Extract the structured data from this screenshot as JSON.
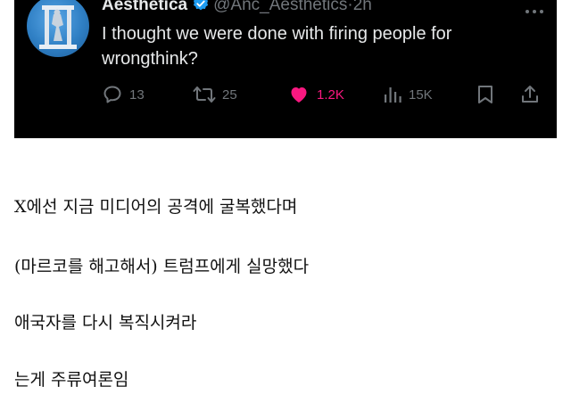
{
  "tweet": {
    "display_name": "Aesthetica",
    "handle": "@Anc_Aesthetics",
    "separator": "·",
    "time": "2h",
    "text": "I thought we were done with firing people for wrongthink?",
    "actions": {
      "replies": "13",
      "reposts": "25",
      "likes": "1.2K",
      "views": "15K"
    },
    "colors": {
      "background": "#000000",
      "verified": "#1d9bf0",
      "like": "#f91880",
      "muted": "#71767b"
    },
    "icons": [
      "verified-badge-icon",
      "more-icon",
      "reply-icon",
      "repost-icon",
      "like-icon",
      "views-icon",
      "bookmark-icon",
      "share-icon"
    ]
  },
  "commentary": [
    "X에선 지금 미디어의 공격에 굴복했다며",
    "(마르코를 해고해서) 트럼프에게 실망했다",
    "애국자를 다시 복직시켜라",
    "는게 주류여론임"
  ]
}
